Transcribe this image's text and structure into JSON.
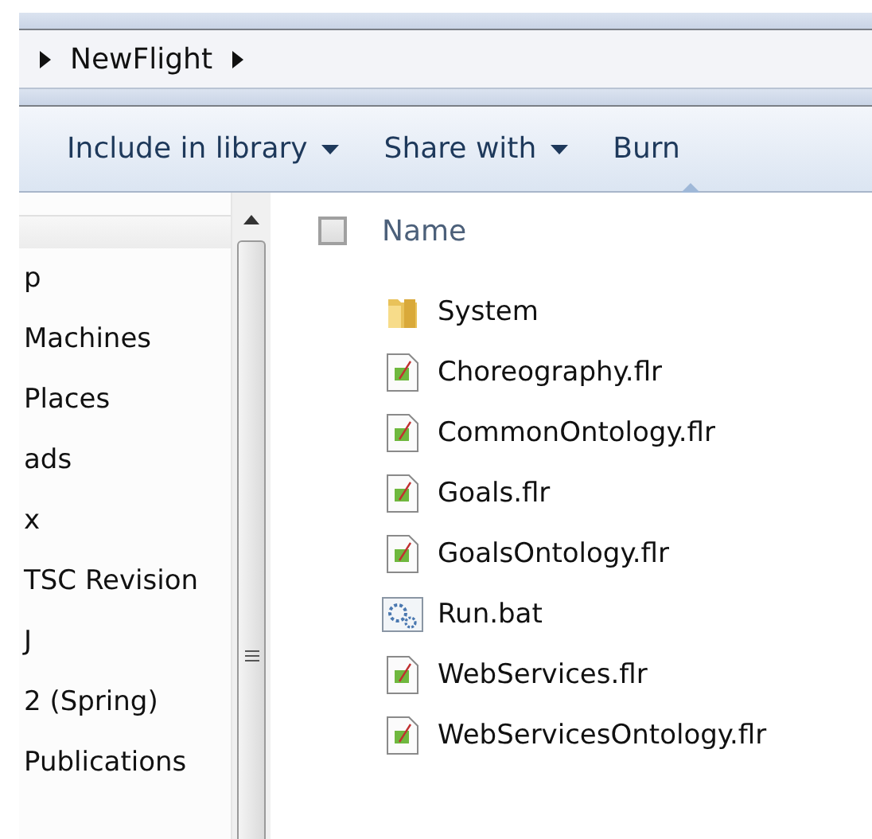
{
  "breadcrumb": {
    "items": [
      "NewFlight"
    ]
  },
  "toolbar": {
    "buttons": [
      {
        "label": "Include in library",
        "dropdown": true
      },
      {
        "label": "Share with",
        "dropdown": true
      },
      {
        "label": "Burn",
        "dropdown": false
      }
    ]
  },
  "navigation_pane": {
    "items": [
      "p",
      "Machines",
      "Places",
      "ads",
      "x",
      "TSC Revision",
      "J",
      "2 (Spring)",
      "Publications"
    ]
  },
  "file_list": {
    "header": {
      "label": "Name",
      "checked": false
    },
    "files": [
      {
        "name": "System",
        "kind": "folder"
      },
      {
        "name": "Choreography.flr",
        "kind": "document"
      },
      {
        "name": "CommonOntology.flr",
        "kind": "document"
      },
      {
        "name": "Goals.flr",
        "kind": "document"
      },
      {
        "name": "GoalsOntology.flr",
        "kind": "document"
      },
      {
        "name": "Run.bat",
        "kind": "batch"
      },
      {
        "name": "WebServices.flr",
        "kind": "document"
      },
      {
        "name": "WebServicesOntology.flr",
        "kind": "document"
      }
    ]
  }
}
